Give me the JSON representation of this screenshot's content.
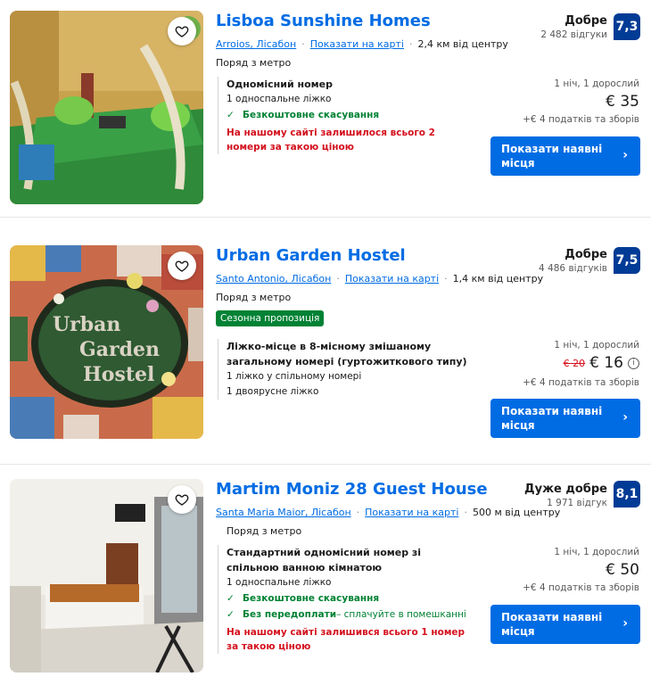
{
  "listings": [
    {
      "title": "Lisboa Sunshine Homes",
      "district": "Arroios, Лісабон",
      "map_link": "Показати на карті",
      "distance": "2,4 км від центру",
      "metro": "Поряд з метро",
      "season_badge": "",
      "room_name": "Одномісний номер",
      "beds": [
        "1 односпальне ліжко"
      ],
      "features": [
        "Безкоштовне скасування"
      ],
      "scarcity": "На нашому сайті залишилося всього 2 номери за такою ціною",
      "score_word": "Добре",
      "reviews": "2 482 відгуки",
      "score": "7,3",
      "nights": "1 ніч, 1 дорослий",
      "old_price": "",
      "price": "€ 35",
      "taxes": "+€ 4 податків та зборів",
      "cta": "Показати наявні місця"
    },
    {
      "title": "Urban Garden Hostel",
      "district": "Santo Antonio, Лісабон",
      "map_link": "Показати на карті",
      "distance": "1,4 км від центру",
      "metro": "Поряд з метро",
      "season_badge": "Сезонна пропозиція",
      "room_name": "Ліжко-місце в 8-місному змішаному загальному номері (гуртожиткового типу)",
      "beds": [
        "1 ліжко у спільному номері",
        "1 двоярусне ліжко"
      ],
      "features": [],
      "scarcity": "",
      "score_word": "Добре",
      "reviews": "4 486 відгуків",
      "score": "7,5",
      "nights": "1 ніч, 1 дорослий",
      "old_price": "€ 20",
      "price": "€ 16",
      "taxes": "+€ 4 податків та зборів",
      "cta": "Показати наявні місця",
      "photo_sign": [
        "Urban",
        "Garden",
        "Hostel"
      ]
    },
    {
      "title": "Martim Moniz 28 Guest House",
      "district": "Santa Maria Maior, Лісабон",
      "map_link": "Показати на карті",
      "distance": "500 м від центру",
      "metro": "Поряд з метро",
      "season_badge": "",
      "room_name": "Стандартний одномісний номер зі спільною ванною кімнатою",
      "beds": [
        "1 односпальне ліжко"
      ],
      "features": [
        "Безкоштовне скасування"
      ],
      "prepay_label": "Без передоплати",
      "prepay_note": " – сплачуйте в помешканні",
      "scarcity": "На нашому сайті залишився всього 1 номер за такою ціною",
      "score_word": "Дуже добре",
      "reviews": "1 971 відгук",
      "score": "8,1",
      "nights": "1 ніч, 1 дорослий",
      "old_price": "",
      "price": "€ 50",
      "taxes": "+€ 4 податків та зборів",
      "cta": "Показати наявні місця"
    }
  ],
  "icons": {
    "favorite": "heart-outline-icon",
    "check": "checkmark-icon",
    "chevron": "chevron-right-icon",
    "info": "info-icon"
  },
  "colors": {
    "link": "#006ce4",
    "score": "#003b95",
    "green": "#008234",
    "red": "#d4111e"
  },
  "glyphs": {
    "check": "✓",
    "chevron": "›",
    "info": "i",
    "dot": "·"
  }
}
